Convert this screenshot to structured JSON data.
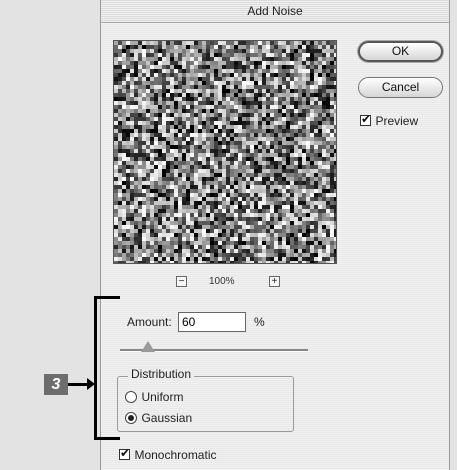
{
  "dialog": {
    "title": "Add Noise",
    "ok_label": "OK",
    "cancel_label": "Cancel",
    "preview_label": "Preview",
    "preview_checked": true,
    "zoom_minus": "−",
    "zoom_level": "100%",
    "zoom_plus": "+",
    "amount_label": "Amount:",
    "amount_value": "60",
    "amount_unit": "%",
    "amount_slider_fraction": 0.15,
    "distribution_title": "Distribution",
    "distribution_options": [
      "Uniform",
      "Gaussian"
    ],
    "distribution_selected": "Gaussian",
    "monochromatic_label": "Monochromatic",
    "monochromatic_checked": true
  },
  "annotation": {
    "callout_number": "3"
  }
}
